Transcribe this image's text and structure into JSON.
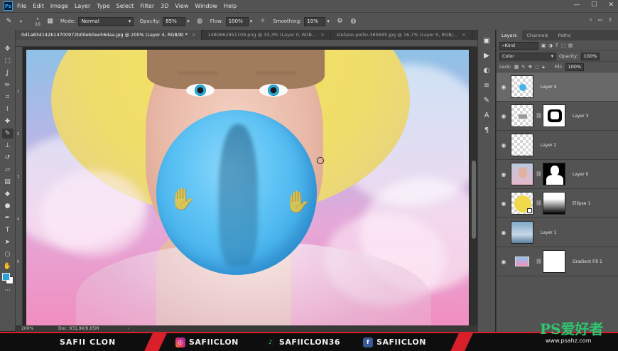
{
  "app": {
    "logo": "Ps"
  },
  "menu": [
    "File",
    "Edit",
    "Image",
    "Layer",
    "Type",
    "Select",
    "Filter",
    "3D",
    "View",
    "Window",
    "Help"
  ],
  "options": {
    "brush_size": "10",
    "mode_label": "Mode:",
    "mode_value": "Normal",
    "opacity_label": "Opacity:",
    "opacity_value": "85%",
    "flow_label": "Flow:",
    "flow_value": "100%",
    "smoothing_label": "Smoothing:",
    "smoothing_value": "10%"
  },
  "tabs": [
    {
      "label": "0d1a834142b14700972b00eb0ee56daa.jpg @ 200% (Layer 4, RGB/8) *",
      "active": true
    },
    {
      "label": "1480662951109.png @ 33,3% (Layer 0, RGB...",
      "active": false
    },
    {
      "label": "stefano-pollio-365695.jpg @ 16,7% (Layer 0, RGB/...",
      "active": false
    }
  ],
  "rulers": {
    "left_marks": [
      "1",
      "2",
      "3",
      "4",
      "5"
    ]
  },
  "status": {
    "zoom": "200%",
    "doc": "Doc: 931,9K/6,65M"
  },
  "panel": {
    "tabs": [
      "Layers",
      "Channels",
      "Paths"
    ],
    "kind_label": "Kind",
    "blend_mode": "Color",
    "opacity_label": "Opacity:",
    "opacity_value": "100%",
    "lock_label": "Lock:",
    "fill_label": "Fill:",
    "fill_value": "100%"
  },
  "layers": [
    {
      "name": "Layer 4",
      "selected": true,
      "mask": false
    },
    {
      "name": "Layer 3",
      "selected": false,
      "mask": true
    },
    {
      "name": "Layer 2",
      "selected": false,
      "mask": false
    },
    {
      "name": "Layer 0",
      "selected": false,
      "mask": true
    },
    {
      "name": "Ellipse 1",
      "selected": false,
      "mask": true
    },
    {
      "name": "Layer 1",
      "selected": false,
      "mask": false
    },
    {
      "name": "Gradient Fill 1",
      "selected": false,
      "mask": true
    }
  ],
  "banner": {
    "name": "SAFII CLON",
    "instagram": "SAFIICLON",
    "tiktok": "SAFIICLON36",
    "facebook": "SAFIICLON"
  },
  "watermark": {
    "brand": "PS爱好者",
    "url": "www.psahz.com"
  },
  "colors": {
    "foreground": "#29a3d6",
    "background": "#ffffff",
    "accent": "#d81f2a"
  }
}
